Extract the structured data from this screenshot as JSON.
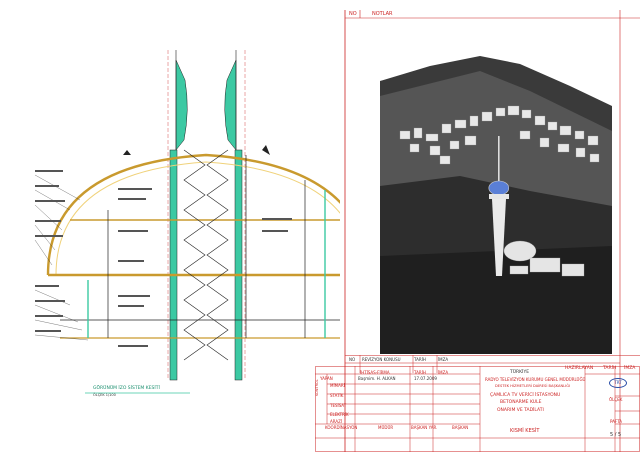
{
  "header": {
    "no_label": "NO",
    "notes_label": "NOTLAR"
  },
  "drawing": {
    "section_caption": "GÖRÜNÜM İZO SİSTEM KESİTİ",
    "section_scale": "ÖLÇEK 1/100",
    "annotations": [
      "dış cephe kaplaması",
      "çelik konstrüksiyon",
      "yalıtım malzemesi",
      "alüminyum levha",
      "beton döşeme",
      "ara kat döşemesi",
      "merdiven",
      "asma tavan",
      "korkuluk",
      "taşıyıcı kolon"
    ]
  },
  "revision_table": {
    "no": "NO",
    "subject": "REVİZYON KONUSU",
    "date": "TARİH",
    "sign": "İMZA"
  },
  "title_block": {
    "prepared": "HAZIRLAYAN",
    "date_label": "TARİH",
    "sign_label": "İMZA",
    "ihtisas": "İHTİSAS-FİRMA",
    "made_by": "YAPAN",
    "engineer": "Başmim. H. ALKAN",
    "made_date": "17.07.2009",
    "disciplines": [
      "MİMARİ",
      "STATİK",
      "TESİSAT",
      "ELEKTRİK",
      "ARAZİ"
    ],
    "control_label": "KONTROL",
    "coordination": "KOORDİNASYON",
    "manager": "MÜDÜR",
    "dept_head": "BAŞKAN YAR.",
    "head": "BAŞKAN",
    "country": "TÜRKİYE",
    "institution": "RADYO TELEVİZYON KURUMU GENEL MÜDÜRLÜĞÜ",
    "department": "DESTEK HİZMETLERİ DAİRESİ BAŞKANLIĞI",
    "project_1": "ÇAMLICA TV VERİCİ İSTASYONU",
    "project_2": "BETONARME KULE",
    "project_3": "ONARIM VE TADİLATI",
    "scale_label": "ÖLÇEK",
    "sheet_title": "KISMİ KESİT",
    "pafta_label": "PAFTA",
    "sheet_no": "5 / 5",
    "logo": "TRT"
  }
}
